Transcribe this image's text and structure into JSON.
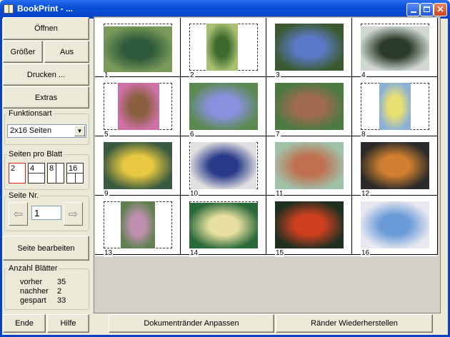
{
  "window": {
    "title": "BookPrint - ..."
  },
  "sidebar": {
    "open_label": "Öffnen",
    "bigger_label": "Größer",
    "off_label": "Aus",
    "print_label": "Drucken ...",
    "extras_label": "Extras",
    "function_group": {
      "legend": "Funktionsart",
      "selected": "2x16 Seiten"
    },
    "pages_per_sheet": {
      "legend": "Seiten pro Blatt",
      "options": [
        "2",
        "4",
        "8",
        "16"
      ],
      "selected": "2"
    },
    "page_nr": {
      "legend": "Seite Nr.",
      "value": "1"
    },
    "edit_page_label": "Seite bearbeiten",
    "sheet_count": {
      "legend": "Anzahl Blätter",
      "rows": [
        {
          "label": "vorher",
          "value": "35"
        },
        {
          "label": "nachher",
          "value": "2"
        },
        {
          "label": "gespart",
          "value": "33"
        }
      ]
    },
    "end_label": "Ende",
    "help_label": "Hilfe"
  },
  "footer": {
    "adjust_margins_label": "Dokumentränder Anpassen",
    "restore_margins_label": "Ränder Wiederherstellen"
  },
  "preview": {
    "pages": [
      {
        "num": "1",
        "image": "butterfly-photo",
        "colors": [
          "#2d5a3a",
          "#7a9a5a"
        ]
      },
      {
        "num": "2",
        "image": "butterfly-photo",
        "colors": [
          "#3e6a2e",
          "#a8c070"
        ]
      },
      {
        "num": "3",
        "image": "butterfly-photo",
        "colors": [
          "#5a7ac8",
          "#3b5a30"
        ]
      },
      {
        "num": "4",
        "image": "butterfly-photo",
        "colors": [
          "#2a3a2a",
          "#d0d8d0"
        ]
      },
      {
        "num": "5",
        "image": "butterfly-photo",
        "colors": [
          "#8a6040",
          "#d070a8"
        ]
      },
      {
        "num": "6",
        "image": "butterfly-photo",
        "colors": [
          "#8a90e0",
          "#5a8a50"
        ]
      },
      {
        "num": "7",
        "image": "butterfly-photo",
        "colors": [
          "#a06a50",
          "#4a7a40"
        ]
      },
      {
        "num": "8",
        "image": "butterfly-photo",
        "colors": [
          "#e8e070",
          "#8ab0d8"
        ]
      },
      {
        "num": "9",
        "image": "butterfly-photo",
        "colors": [
          "#e8c840",
          "#3a5a40"
        ]
      },
      {
        "num": "10",
        "image": "butterfly-photo",
        "colors": [
          "#2a3a8a",
          "#e0e0e0"
        ]
      },
      {
        "num": "11",
        "image": "butterfly-photo",
        "colors": [
          "#c07050",
          "#a0c0a8"
        ]
      },
      {
        "num": "12",
        "image": "butterfly-photo",
        "colors": [
          "#d08030",
          "#2a2a2a"
        ]
      },
      {
        "num": "13",
        "image": "butterfly-photo",
        "colors": [
          "#c090b0",
          "#608050"
        ]
      },
      {
        "num": "14",
        "image": "butterfly-photo",
        "colors": [
          "#e8e0a0",
          "#2a6a3a"
        ]
      },
      {
        "num": "15",
        "image": "butterfly-photo",
        "colors": [
          "#d04020",
          "#203020"
        ]
      },
      {
        "num": "16",
        "image": "butterfly-photo",
        "colors": [
          "#6a9ad8",
          "#e8e8f0"
        ]
      }
    ]
  }
}
